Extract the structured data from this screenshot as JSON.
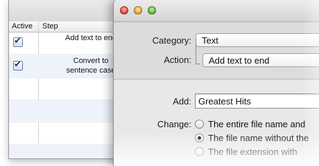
{
  "steps_table": {
    "columns": [
      "Active",
      "Step"
    ],
    "rows": [
      {
        "active": true,
        "step": "Add text to end"
      },
      {
        "active": true,
        "step_line1": "Convert to",
        "step_line2": "sentence case"
      }
    ]
  },
  "window": {
    "buttons": [
      "close",
      "minimize",
      "zoom"
    ]
  },
  "form": {
    "category_label": "Category:",
    "category_value": "Text",
    "action_label": "Action:",
    "action_value": "Add text to end",
    "add_label": "Add:",
    "add_value": "Greatest Hits",
    "change_label": "Change:",
    "change_options": [
      {
        "label": "The entire file name and",
        "selected": false
      },
      {
        "label": "The file name without the",
        "selected": true
      },
      {
        "label": "The file extension with",
        "selected": false
      }
    ]
  }
}
